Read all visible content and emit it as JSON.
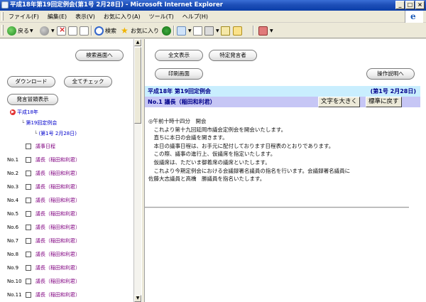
{
  "window": {
    "title": "平成18年第19回定例会(第1号 2月28日) - Microsoft Internet Explorer",
    "minimize": "_",
    "maximize": "□",
    "close": "×"
  },
  "menu": [
    "ファイル(F)",
    "編集(E)",
    "表示(V)",
    "お気に入り(A)",
    "ツール(T)",
    "ヘルプ(H)"
  ],
  "toolbar": {
    "back": "戻る",
    "search": "検索",
    "favorites": "お気に入り"
  },
  "left": {
    "search_screen": "検索画面へ",
    "download": "ダウンロード",
    "check_all": "全てチェック",
    "speaker_list": "発言冒頭表示",
    "tree": {
      "year": "平成18年",
      "session": "第19回定例会",
      "meeting": "(第1号 2月28日)",
      "agenda": "議事日程"
    },
    "rows": [
      {
        "no": "No.1",
        "speaker": "議長（稲田和利君）"
      },
      {
        "no": "No.2",
        "speaker": "議長（稲田和利君）"
      },
      {
        "no": "No.3",
        "speaker": "議長（稲田和利君）"
      },
      {
        "no": "No.4",
        "speaker": "議長（稲田和利君）"
      },
      {
        "no": "No.5",
        "speaker": "議長（稲田和利君）"
      },
      {
        "no": "No.6",
        "speaker": "議長（稲田和利君）"
      },
      {
        "no": "No.7",
        "speaker": "議長（稲田和利君）"
      },
      {
        "no": "No.8",
        "speaker": "議長（稲田和利君）"
      },
      {
        "no": "No.9",
        "speaker": "議長（稲田和利君）"
      },
      {
        "no": "No.10",
        "speaker": "議長（稲田和利君）"
      },
      {
        "no": "No.11",
        "speaker": "議長（稲田和利君）"
      }
    ]
  },
  "right": {
    "show_all": "全文表示",
    "specific_speaker": "特定発言者",
    "print_screen": "印刷画面",
    "help": "操作説明へ",
    "header_session": "平成18年 第19回定例会",
    "header_date": "(第1号 2月28日)",
    "header_speaker": "No.1 議長（稲田和利君）",
    "enlarge": "文字を大きく",
    "reset": "標準に戻す",
    "body": [
      "◎午前十時十四分　開会",
      "",
      "　これより第十九回延岡市議会定例会を開会いたします。",
      "　直ちに本日の会議を開きます。",
      "　本日の議事日程は、お手元に配付しております日程表のとおりであります。",
      "　この際、議事の進行上、仮議席を指定いたします。",
      "　仮議席は、ただいま御着席の議席といたします。",
      "　これより今期定例会における会議録署名議員の指名を行います。会議録署名議員に",
      "佐藤大志議員と高橋　勝議員を指名いたします。"
    ]
  }
}
